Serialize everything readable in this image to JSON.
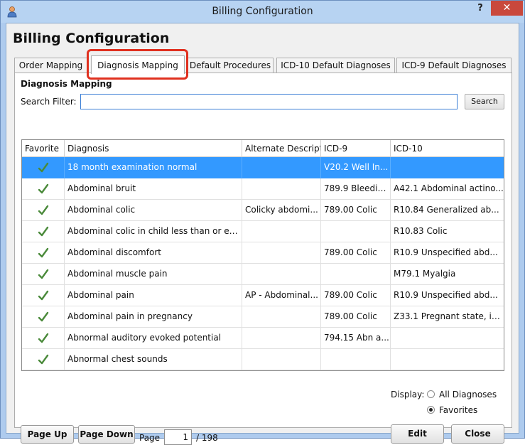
{
  "window": {
    "title": "Billing Configuration",
    "help": "?",
    "close": "✕"
  },
  "heading": "Billing Configuration",
  "tabs": [
    {
      "label": "Order Mapping"
    },
    {
      "label": "Diagnosis Mapping",
      "active": true
    },
    {
      "label": "Default Procedures"
    },
    {
      "label": "ICD-10 Default Diagnoses"
    },
    {
      "label": "ICD-9 Default Diagnoses"
    }
  ],
  "section_title": "Diagnosis Mapping",
  "search": {
    "label": "Search Filter:",
    "value": "",
    "button": "Search"
  },
  "grid": {
    "columns": [
      "Favorite",
      "Diagnosis",
      "Alternate Descript",
      "ICD-9",
      "ICD-10"
    ],
    "rows": [
      {
        "favorite": true,
        "diagnosis": "18 month examination normal",
        "alternate": "",
        "icd9": "V20.2  Well In...",
        "icd10": "",
        "selected": true
      },
      {
        "favorite": true,
        "diagnosis": "Abdominal bruit",
        "alternate": "",
        "icd9": "789.9  Bleedin...",
        "icd10": "A42.1  Abdominal actino..."
      },
      {
        "favorite": true,
        "diagnosis": "Abdominal colic",
        "alternate": "Colicky abdomi...",
        "icd9": "789.00  Colic",
        "icd10": "R10.84  Generalized ab..."
      },
      {
        "favorite": true,
        "diagnosis": "Abdominal colic in child less than or eq...",
        "alternate": "",
        "icd9": "",
        "icd10": "R10.83  Colic"
      },
      {
        "favorite": true,
        "diagnosis": "Abdominal discomfort",
        "alternate": "",
        "icd9": "789.00  Colic",
        "icd10": "R10.9  Unspecified abd..."
      },
      {
        "favorite": true,
        "diagnosis": "Abdominal muscle pain",
        "alternate": "",
        "icd9": "",
        "icd10": "M79.1  Myalgia"
      },
      {
        "favorite": true,
        "diagnosis": "Abdominal pain",
        "alternate": "AP - Abdominal...",
        "icd9": "789.00  Colic",
        "icd10": "R10.9  Unspecified abd..."
      },
      {
        "favorite": true,
        "diagnosis": "Abdominal pain in pregnancy",
        "alternate": "",
        "icd9": "789.00  Colic",
        "icd10": "Z33.1  Pregnant state, in..."
      },
      {
        "favorite": true,
        "diagnosis": "Abnormal auditory evoked potential",
        "alternate": "",
        "icd9": "794.15  Abn a...",
        "icd10": ""
      },
      {
        "favorite": true,
        "diagnosis": "Abnormal chest sounds",
        "alternate": "",
        "icd9": "",
        "icd10": ""
      }
    ]
  },
  "display": {
    "label": "Display:",
    "options": [
      {
        "label": "All Diagnoses",
        "selected": false
      },
      {
        "label": "Favorites",
        "selected": true
      }
    ]
  },
  "pagination": {
    "page_up": "Page Up",
    "page_down": "Page Down",
    "page_label": "Page",
    "current": "1",
    "total": "/ 198"
  },
  "actions": {
    "edit": "Edit",
    "close": "Close"
  },
  "colors": {
    "selection": "#3399ff",
    "check": "#4a8a3a",
    "highlight": "#e0301f"
  }
}
